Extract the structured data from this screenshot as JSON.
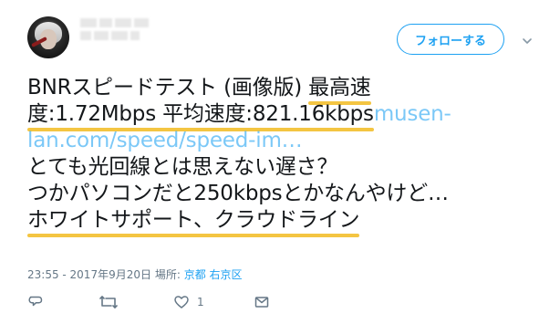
{
  "header": {
    "follow_label": "フォローする"
  },
  "tweet": {
    "lines": [
      [
        "BNRスピードテスト (画像版) ",
        "最高速"
      ],
      [
        "度:1.72Mbps 平均速度:821.16kbps ",
        "musen-"
      ],
      [
        "lan.com/speed/speed-im…"
      ],
      [
        "とても光回線とは思えない遅さ？"
      ],
      [
        "つかパソコンだと250kbpsとかなんやけど…"
      ],
      [
        "ホワイトサポート、クラウドライン"
      ]
    ],
    "meta": {
      "time": "23:55 - 2017年9月20日",
      "place_label": "場所:",
      "place": "京都 右京区"
    }
  },
  "actions": {
    "reply_icon": "reply-icon",
    "retweet_icon": "retweet-icon",
    "like_icon": "like-icon",
    "like_count": "1",
    "dm_icon": "mail-icon"
  },
  "colors": {
    "accent": "#1da1f2",
    "highlight": "#f4c542",
    "text": "#14171a",
    "muted": "#657786"
  }
}
